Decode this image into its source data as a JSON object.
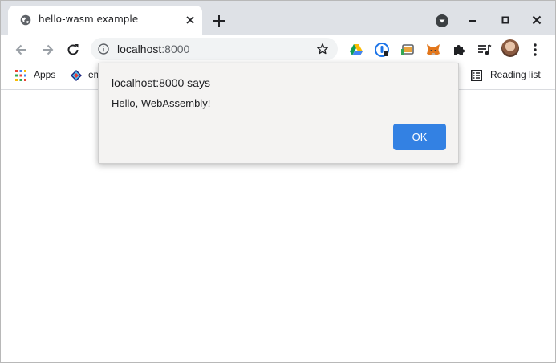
{
  "tab": {
    "title": "hello-wasm example"
  },
  "toolbar": {
    "url_host": "localhost",
    "url_port": ":8000"
  },
  "bookmarks": {
    "apps_label": "Apps",
    "item_label": "em",
    "reading_list_label": "Reading list"
  },
  "dialog": {
    "title": "localhost:8000 says",
    "message": "Hello, WebAssembly!",
    "ok_label": "OK"
  },
  "colors": {
    "tabstrip": "#dee1e6",
    "omnibox": "#f1f3f4",
    "dialog_bg": "#f4f3f2",
    "ok_button": "#3381e3"
  },
  "icons": [
    "globe-icon",
    "close-icon",
    "plus-icon",
    "tab-search-icon",
    "minimize-icon",
    "maximize-icon",
    "back-icon",
    "forward-icon",
    "reload-icon",
    "info-icon",
    "star-icon",
    "google-drive-icon",
    "password-icon",
    "cast-icon",
    "metamask-icon",
    "extensions-icon",
    "media-queue-icon",
    "avatar",
    "more-icon",
    "apps-grid-icon",
    "bookmark-favicon",
    "reading-list-icon"
  ]
}
